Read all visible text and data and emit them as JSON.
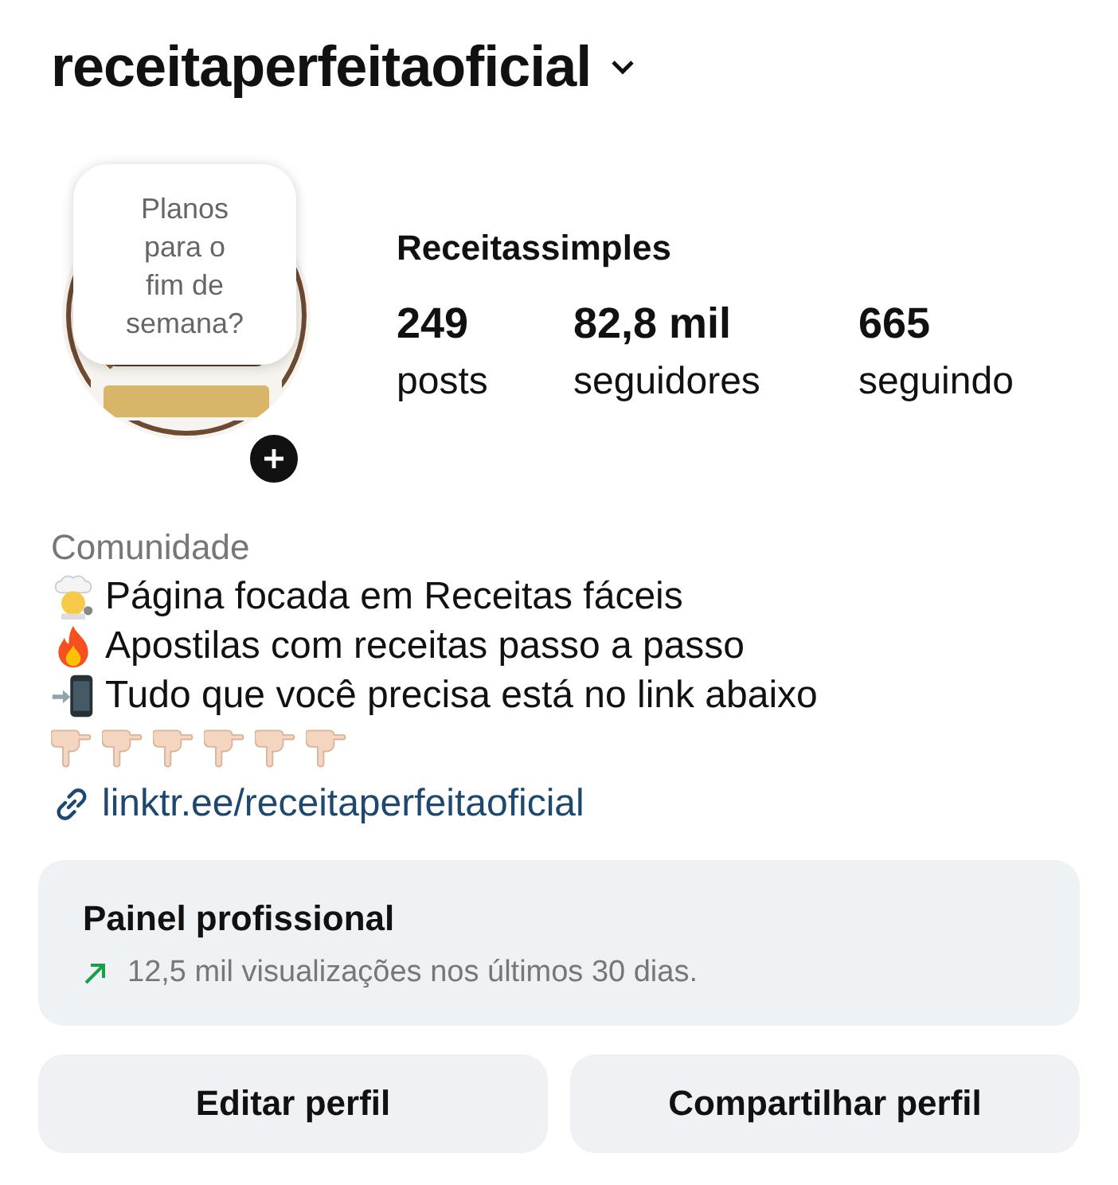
{
  "username": "receitaperfeitaoficial",
  "note": {
    "text": "Planos para o fim de semana?"
  },
  "display_name": "Receitassimples",
  "stats": [
    {
      "value": "249",
      "label": "posts"
    },
    {
      "value": "82,8 mil",
      "label": "seguidores"
    },
    {
      "value": "665",
      "label": "seguindo"
    }
  ],
  "bio": {
    "category": "Comunidade",
    "lines": [
      {
        "kind": "chef",
        "text": "Página focada em Receitas fáceis"
      },
      {
        "kind": "fire",
        "text": "Apostilas com receitas passo a passo"
      },
      {
        "kind": "phone",
        "text": "Tudo que você precisa está no link abaixo"
      },
      {
        "kind": "hands"
      }
    ],
    "link": "linktr.ee/receitaperfeitaoficial"
  },
  "dashboard": {
    "title": "Painel profissional",
    "trending_up": true,
    "summary": "12,5 mil visualizações nos últimos 30 dias."
  },
  "buttons": [
    "Editar perfil",
    "Compartilhar perfil"
  ]
}
